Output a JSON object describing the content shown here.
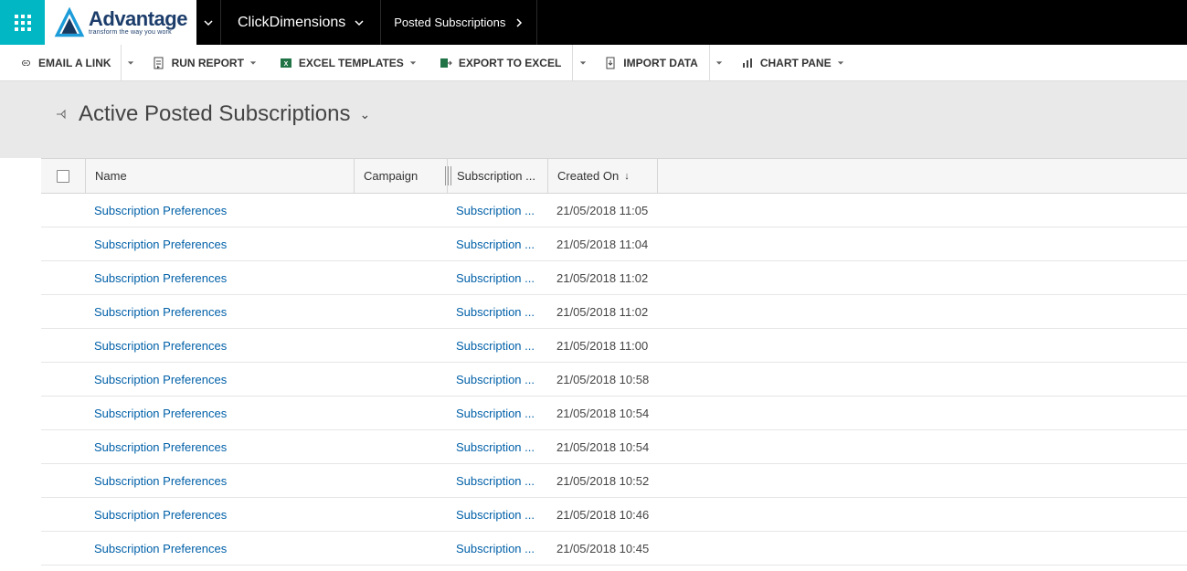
{
  "logo": {
    "brand": "Advantage",
    "tagline": "transform the way you work"
  },
  "topnav": {
    "area": "ClickDimensions",
    "entity": "Posted Subscriptions"
  },
  "commands": {
    "email": "EMAIL A LINK",
    "report": "RUN REPORT",
    "excel_tpl": "EXCEL TEMPLATES",
    "export": "EXPORT TO EXCEL",
    "import": "IMPORT DATA",
    "chart": "CHART PANE"
  },
  "view": {
    "title": "Active Posted Subscriptions"
  },
  "columns": {
    "name": "Name",
    "campaign": "Campaign",
    "subscription": "Subscription ...",
    "created": "Created On"
  },
  "rows": [
    {
      "name": "Subscription Preferences",
      "campaign": "",
      "subscription": "Subscription ...",
      "created": "21/05/2018 11:05"
    },
    {
      "name": "Subscription Preferences",
      "campaign": "",
      "subscription": "Subscription ...",
      "created": "21/05/2018 11:04"
    },
    {
      "name": "Subscription Preferences",
      "campaign": "",
      "subscription": "Subscription ...",
      "created": "21/05/2018 11:02"
    },
    {
      "name": "Subscription Preferences",
      "campaign": "",
      "subscription": "Subscription ...",
      "created": "21/05/2018 11:02"
    },
    {
      "name": "Subscription Preferences",
      "campaign": "",
      "subscription": "Subscription ...",
      "created": "21/05/2018 11:00"
    },
    {
      "name": "Subscription Preferences",
      "campaign": "",
      "subscription": "Subscription ...",
      "created": "21/05/2018 10:58"
    },
    {
      "name": "Subscription Preferences",
      "campaign": "",
      "subscription": "Subscription ...",
      "created": "21/05/2018 10:54"
    },
    {
      "name": "Subscription Preferences",
      "campaign": "",
      "subscription": "Subscription ...",
      "created": "21/05/2018 10:54"
    },
    {
      "name": "Subscription Preferences",
      "campaign": "",
      "subscription": "Subscription ...",
      "created": "21/05/2018 10:52"
    },
    {
      "name": "Subscription Preferences",
      "campaign": "",
      "subscription": "Subscription ...",
      "created": "21/05/2018 10:46"
    },
    {
      "name": "Subscription Preferences",
      "campaign": "",
      "subscription": "Subscription ...",
      "created": "21/05/2018 10:45"
    }
  ]
}
